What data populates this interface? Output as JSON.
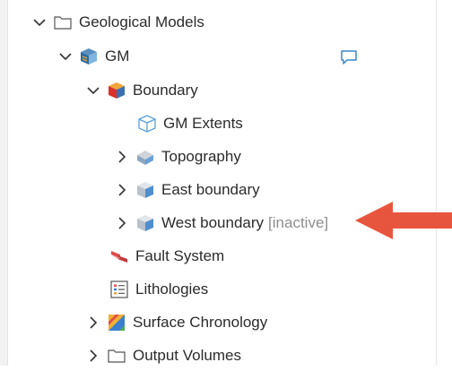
{
  "tree": {
    "root": {
      "label": "Geological Models",
      "icon": "folder-icon",
      "state": "expanded"
    },
    "gm": {
      "label": "GM",
      "icon": "geological-model-icon",
      "state": "expanded",
      "comment_icon": "comment-icon"
    },
    "boundary": {
      "label": "Boundary",
      "icon": "boundary-icon",
      "state": "expanded"
    },
    "gm_extents": {
      "label": "GM Extents",
      "icon": "extents-box-icon"
    },
    "topography": {
      "label": "Topography",
      "icon": "topography-icon",
      "state": "collapsed"
    },
    "east_boundary": {
      "label": "East boundary",
      "icon": "boundary-cube-icon",
      "state": "collapsed"
    },
    "west_boundary": {
      "label": "West boundary",
      "status": "[inactive]",
      "icon": "boundary-cube-icon",
      "state": "collapsed"
    },
    "fault_system": {
      "label": "Fault System",
      "icon": "fault-system-icon"
    },
    "lithologies": {
      "label": "Lithologies",
      "icon": "lithologies-list-icon"
    },
    "surface_chronology": {
      "label": "Surface Chronology",
      "icon": "surface-chronology-icon",
      "state": "collapsed"
    },
    "output_volumes": {
      "label": "Output Volumes",
      "icon": "folder-icon",
      "state": "collapsed"
    }
  },
  "annotation": {
    "icon": "red-arrow-icon",
    "color": "#e8553e"
  }
}
